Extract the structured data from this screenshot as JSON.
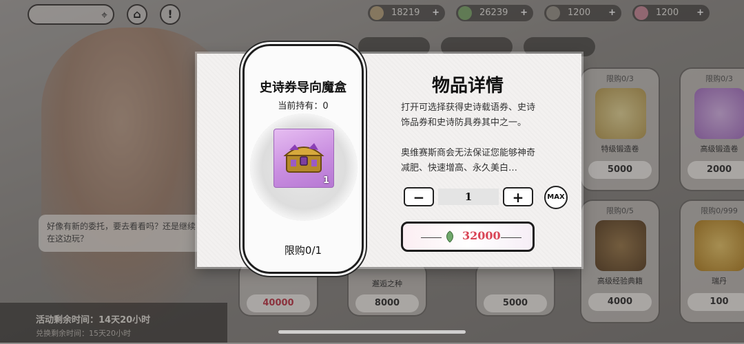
{
  "topbar": {
    "currencies": [
      {
        "value": "18219"
      },
      {
        "value": "26239"
      },
      {
        "value": "1200"
      },
      {
        "value": "1200"
      }
    ],
    "plus": "+"
  },
  "shop": {
    "cards": [
      {
        "limit": "限购0/3",
        "price": "5000"
      },
      {
        "limit": "限购0/3",
        "price": "2000"
      },
      {
        "limit": "限购0/5",
        "price": "4000"
      },
      {
        "limit": "限购0/999",
        "price": "100"
      },
      {
        "name": "邂逅之种",
        "price": "8000"
      },
      {
        "price": "5000"
      },
      {
        "price": "40000"
      }
    ],
    "names_right": [
      "特级锻造卷",
      "高级锻造卷",
      "高级经验典籍",
      "瑞丹"
    ]
  },
  "background": {
    "bubble_text": "好像有新的委托，要去看看吗？还是继续在这边玩？",
    "activity_time": "活动剩余时间：14天20小时",
    "redeem_time": "兑换剩余时间：15天20小时"
  },
  "dialog": {
    "item_name": "史诗券导向魔盒",
    "owned": "当前持有：0",
    "icon_count": "1",
    "limit": "限购0/1",
    "title": "物品详情",
    "desc1": "打开可选择获得史诗载语券、史诗饰品券和史诗防具券其中之一。",
    "desc2": "奥维赛斯商会无法保证您能够神奇减肥、快速增高、永久美白…",
    "quantity": "1",
    "minus": "−",
    "plus": "+",
    "max": "MAX",
    "price": "32000"
  }
}
